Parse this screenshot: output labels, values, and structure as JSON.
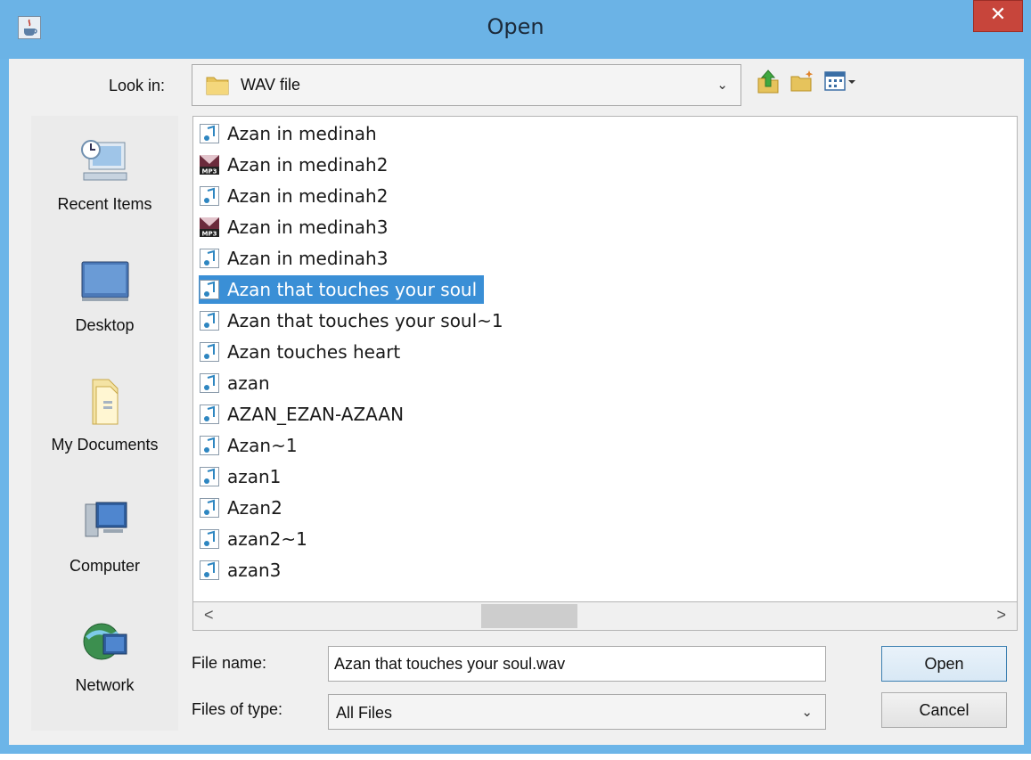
{
  "window": {
    "title": "Open",
    "close_glyph": "✕"
  },
  "lookin": {
    "label": "Look in:",
    "value": "WAV file",
    "arrow": "⌄"
  },
  "toolbar": {
    "up_icon": "up-folder-icon",
    "new_folder_icon": "new-folder-icon",
    "view_menu_icon": "view-menu-icon"
  },
  "places": [
    {
      "label": "Recent Items",
      "icon": "recent-items-icon"
    },
    {
      "label": "Desktop",
      "icon": "desktop-icon"
    },
    {
      "label": "My Documents",
      "icon": "my-documents-icon"
    },
    {
      "label": "Computer",
      "icon": "computer-icon"
    },
    {
      "label": "Network",
      "icon": "network-icon"
    }
  ],
  "files": [
    {
      "name": "Azan in medinah",
      "type": "audio"
    },
    {
      "name": "Azan in medinah2",
      "type": "mp3"
    },
    {
      "name": "Azan in medinah2",
      "type": "audio"
    },
    {
      "name": "Azan in medinah3",
      "type": "mp3"
    },
    {
      "name": "Azan in medinah3",
      "type": "audio"
    },
    {
      "name": "Azan that touches your soul",
      "type": "audio",
      "selected": true
    },
    {
      "name": "Azan that touches your soul~1",
      "type": "audio"
    },
    {
      "name": "Azan touches heart",
      "type": "audio"
    },
    {
      "name": "azan",
      "type": "audio"
    },
    {
      "name": "AZAN_EZAN-AZAAN",
      "type": "audio"
    },
    {
      "name": "Azan~1",
      "type": "audio"
    },
    {
      "name": "azan1",
      "type": "audio"
    },
    {
      "name": "Azan2",
      "type": "audio"
    },
    {
      "name": "azan2~1",
      "type": "audio"
    },
    {
      "name": "azan3",
      "type": "audio"
    }
  ],
  "scroll": {
    "left": "<",
    "right": ">"
  },
  "filename": {
    "label": "File name:",
    "value": "Azan that touches your soul.wav"
  },
  "filetype": {
    "label": "Files of type:",
    "value": "All Files",
    "arrow": "⌄"
  },
  "buttons": {
    "open": "Open",
    "cancel": "Cancel"
  },
  "colors": {
    "accent": "#3a8fd6",
    "titlebar": "#6bb3e6",
    "close": "#c7453b"
  }
}
